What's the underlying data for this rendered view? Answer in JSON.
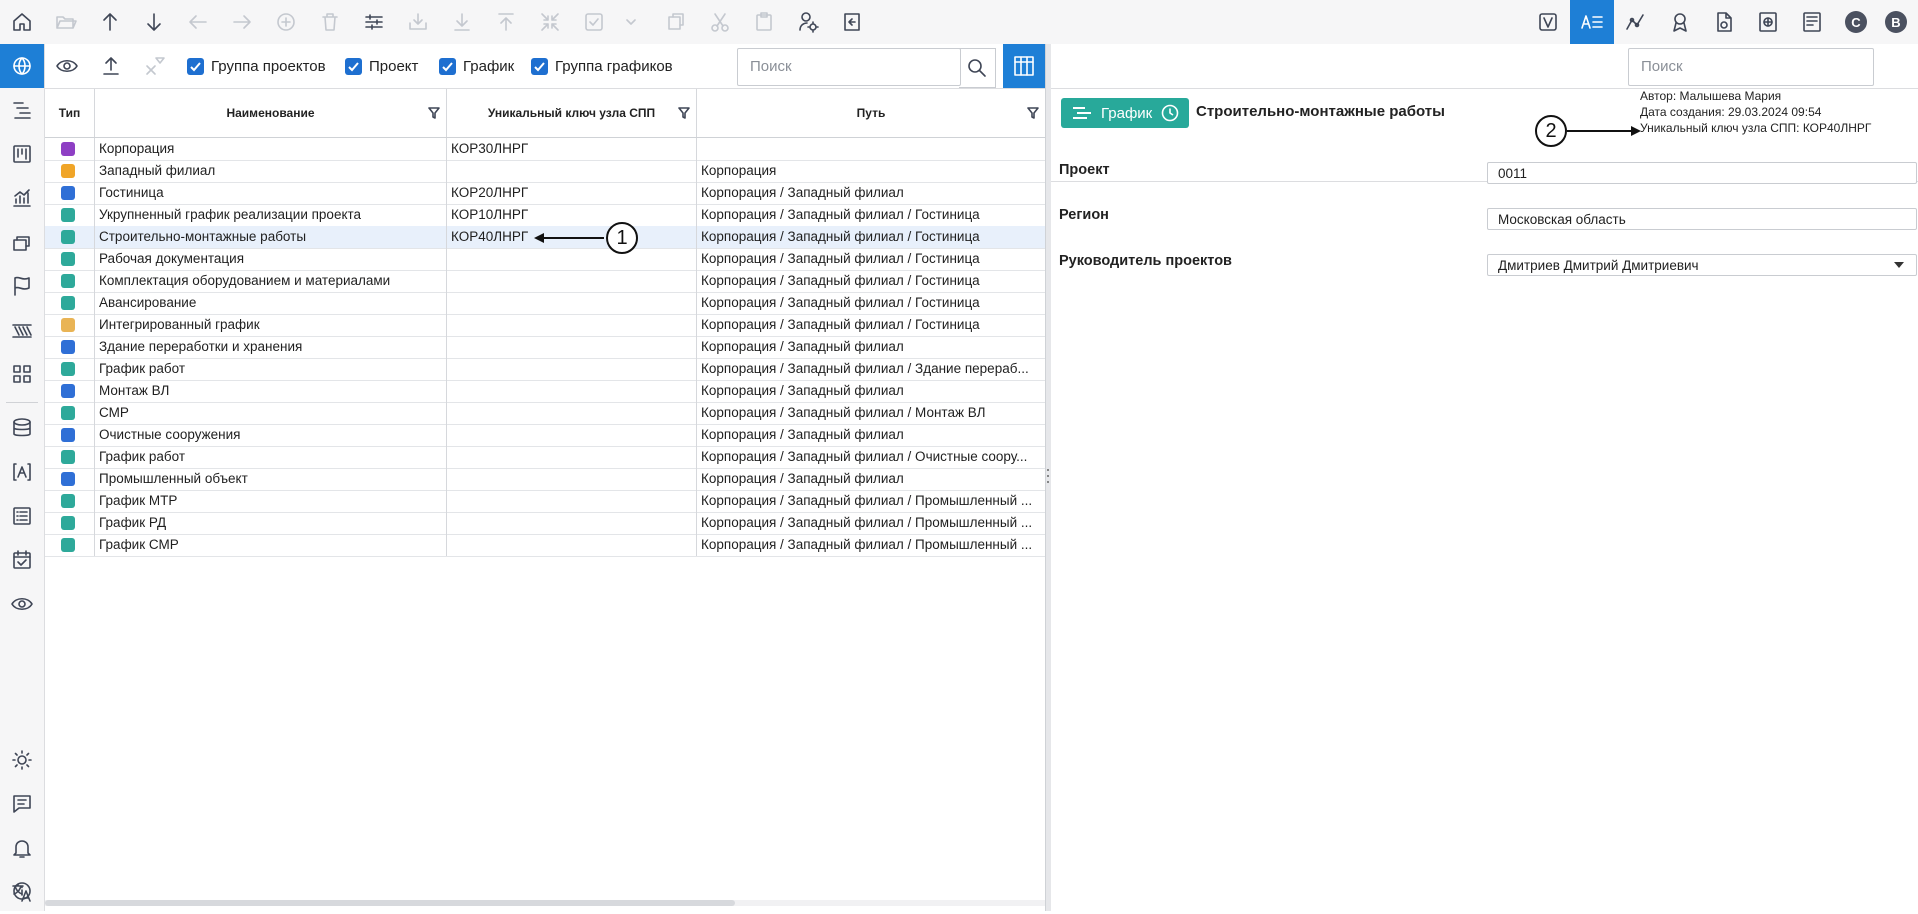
{
  "toolbar": {
    "left_icons": [
      "home-icon",
      "open-folder-icon",
      "move-up-icon",
      "move-down-icon",
      "back-icon",
      "forward-icon",
      "add-icon",
      "delete-icon",
      "settings-sliders-icon",
      "import-icon",
      "download-icon",
      "upload-icon",
      "collapse-icon",
      "check-icon",
      "dropdown-icon",
      "copy-icon",
      "cut-icon",
      "paste-icon",
      "config-icon",
      "exit-icon"
    ],
    "right_icons": [
      "v-icon",
      "attributes-icon",
      "chart-icon",
      "award-icon",
      "document-icon",
      "globe-doc-icon",
      "report-icon",
      "c-avatar",
      "b-avatar"
    ],
    "avatar_c": "C",
    "avatar_b": "B"
  },
  "leftrail": [
    "globe-icon",
    "gantt-icon",
    "kanban-icon",
    "analytics-icon",
    "layers-icon",
    "flag-icon",
    "stairs-icon",
    "grid-icon",
    "database-icon",
    "text-icon",
    "list-icon",
    "calendar-check-icon",
    "eye-icon",
    "sun-icon",
    "chat-icon",
    "bell-icon",
    "translate-icon",
    "info-icon"
  ],
  "filters": {
    "cb1": "Группа проектов",
    "cb2": "Проект",
    "cb3": "График",
    "cb4": "Группа графиков",
    "search_placeholder": "Поиск"
  },
  "table": {
    "headers": {
      "type": "Тип",
      "name": "Наименование",
      "key": "Уникальный ключ узла СПП",
      "path": "Путь"
    },
    "rows": [
      {
        "icon_color": "#8e3fc4",
        "name": "Корпорация",
        "key": "КОР30ЛНРГ",
        "path": ""
      },
      {
        "icon_color": "#f0a528",
        "name": "Западный филиал",
        "key": "",
        "path": "Корпорация"
      },
      {
        "icon_color": "#2f6fd6",
        "name": "Гостиница",
        "key": "КОР20ЛНРГ",
        "path": "Корпорация / Западный филиал"
      },
      {
        "icon_color": "#2ea99a",
        "name": "Укрупненный график реализации проекта",
        "key": "КОР10ЛНРГ",
        "path": "Корпорация / Западный филиал / Гостиница"
      },
      {
        "icon_color": "#2ea99a",
        "name": "Строительно-монтажные работы",
        "key": "КОР40ЛНРГ",
        "path": "Корпорация / Западный филиал / Гостиница"
      },
      {
        "icon_color": "#2ea99a",
        "name": "Рабочая документация",
        "key": "",
        "path": "Корпорация / Западный филиал / Гостиница"
      },
      {
        "icon_color": "#2ea99a",
        "name": "Комплектация оборудованием и материалами",
        "key": "",
        "path": "Корпорация / Западный филиал / Гостиница"
      },
      {
        "icon_color": "#2ea99a",
        "name": "Авансирование",
        "key": "",
        "path": "Корпорация / Западный филиал / Гостиница"
      },
      {
        "icon_color": "#e9b455",
        "name": "Интегрированный график",
        "key": "",
        "path": "Корпорация / Западный филиал / Гостиница"
      },
      {
        "icon_color": "#2f6fd6",
        "name": "Здание переработки и хранения",
        "key": "",
        "path": "Корпорация / Западный филиал"
      },
      {
        "icon_color": "#2ea99a",
        "name": "График работ",
        "key": "",
        "path": "Корпорация / Западный филиал / Здание перераб..."
      },
      {
        "icon_color": "#2f6fd6",
        "name": "Монтаж ВЛ",
        "key": "",
        "path": "Корпорация / Западный филиал"
      },
      {
        "icon_color": "#2ea99a",
        "name": "СМР",
        "key": "",
        "path": "Корпорация / Западный филиал / Монтаж ВЛ"
      },
      {
        "icon_color": "#2f6fd6",
        "name": "Очистные сооружения",
        "key": "",
        "path": "Корпорация / Западный филиал"
      },
      {
        "icon_color": "#2ea99a",
        "name": "График работ",
        "key": "",
        "path": "Корпорация / Западный филиал / Очистные соору..."
      },
      {
        "icon_color": "#2f6fd6",
        "name": "Промышленный объект",
        "key": "",
        "path": "Корпорация / Западный филиал"
      },
      {
        "icon_color": "#2ea99a",
        "name": "График МТР",
        "key": "",
        "path": "Корпорация / Западный филиал / Промышленный ..."
      },
      {
        "icon_color": "#2ea99a",
        "name": "График РД",
        "key": "",
        "path": "Корпорация / Западный филиал / Промышленный ..."
      },
      {
        "icon_color": "#2ea99a",
        "name": "График СМР",
        "key": "",
        "path": "Корпорация / Западный филиал / Промышленный ..."
      }
    ],
    "selected_row": 4
  },
  "right": {
    "search_placeholder": "Поиск",
    "chip_label": "График",
    "title": "Строительно-монтажные работы",
    "meta_author": "Автор: Малышева Мария",
    "meta_date": "Дата создания: 29.03.2024 09:54",
    "meta_key": "Уникальный ключ узла СПП: КОР40ЛНРГ",
    "fields": [
      {
        "label": "Проект",
        "value": "0011"
      },
      {
        "label": "Регион",
        "value": "Московская область"
      },
      {
        "label": "Руководитель проектов",
        "value": "Дмитриев Дмитрий Дмитриевич"
      }
    ]
  },
  "callouts": {
    "one": "1",
    "two": "2"
  },
  "colors": {
    "accent": "#1e7fd6",
    "chip": "#28a99a",
    "selected_row": "#e8f0fb"
  }
}
